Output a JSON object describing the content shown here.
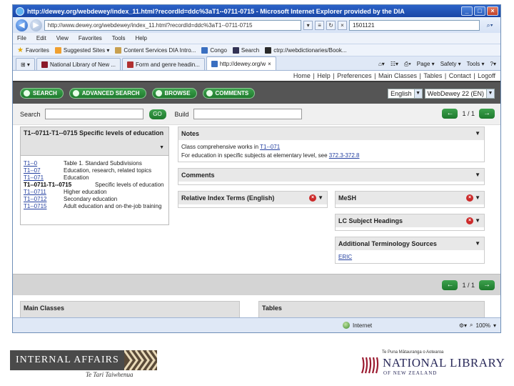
{
  "browser": {
    "title": "http://dewey.org/webdewey/index_11.html?recordId=ddc%3aT1--0711-0715 - Microsoft Internet Explorer provided by the DIA",
    "address": "http://www.dewey.org/webdewey/index_11.html?recordId=ddc%3aT1--0711-0715",
    "search_value": "1501121",
    "menu": [
      "File",
      "Edit",
      "View",
      "Favorites",
      "Tools",
      "Help"
    ],
    "favorites_label": "Favorites",
    "favorites": [
      "Suggested Sites ▾",
      "Content Services DIA Intro...",
      "Congo",
      "Search",
      "ctrp://webdictionaries/Book..."
    ],
    "tabs": [
      "National Library of New ...",
      "Form and genre headin...",
      "http://dewey.org/w"
    ],
    "tab_tools": [
      "Page ▾",
      "Safety ▾",
      "Tools ▾"
    ],
    "status_zone": "Internet",
    "zoom": "100%"
  },
  "webdewey": {
    "top_links": [
      "Home",
      "Help",
      "Preferences",
      "Main Classes",
      "Tables",
      "Contact",
      "Logoff"
    ],
    "nav_buttons": [
      "SEARCH",
      "ADVANCED SEARCH",
      "BROWSE",
      "COMMENTS"
    ],
    "language": "English",
    "edition": "WebDewey 22 (EN)",
    "search_label": "Search",
    "go_label": "GO",
    "build_label": "Build",
    "pager": "1 / 1",
    "record_title": "T1--0711-T1--0715 Specific levels of education",
    "hierarchy": [
      {
        "code": "T1--0",
        "desc": "Table 1. Standard Subdivisions"
      },
      {
        "code": "T1--07",
        "desc": "Education, research, related topics"
      },
      {
        "code": "T1--071",
        "desc": "Education"
      },
      {
        "code": "T1--0711-T1--0715",
        "desc": "Specific levels of education",
        "current": true
      },
      {
        "code": "T1--0711",
        "desc": "Higher education"
      },
      {
        "code": "T1--0712",
        "desc": "Secondary education"
      },
      {
        "code": "T1--0715",
        "desc": "Adult education and on-the-job training"
      }
    ],
    "notes": {
      "title": "Notes",
      "line1_text": "Class comprehensive works in ",
      "line1_link": "T1--071",
      "line2_text": "For education in specific subjects at elementary level, see ",
      "line2_link": "372.3-372.8"
    },
    "comments_title": "Comments",
    "relative_index_title": "Relative Index Terms (English)",
    "mesh_title": "MeSH",
    "lc_title": "LC Subject Headings",
    "additional_title": "Additional Terminology Sources",
    "additional_item": "ERIC",
    "main_classes_title": "Main Classes",
    "tables_title": "Tables"
  },
  "footer": {
    "ia_name": "INTERNAL AFFAIRS",
    "ia_sub": "Te Tari Taiwhenua",
    "nl_small": "Te Puna Mātauranga o Aotearoa",
    "nl_name": "NATIONAL LIBRARY",
    "nl_sub": "OF NEW ZEALAND"
  },
  "colors": {
    "green_button": "#2a8c3a",
    "toolbar_gray": "#555555",
    "ie_blue": "#1f4fb0"
  }
}
